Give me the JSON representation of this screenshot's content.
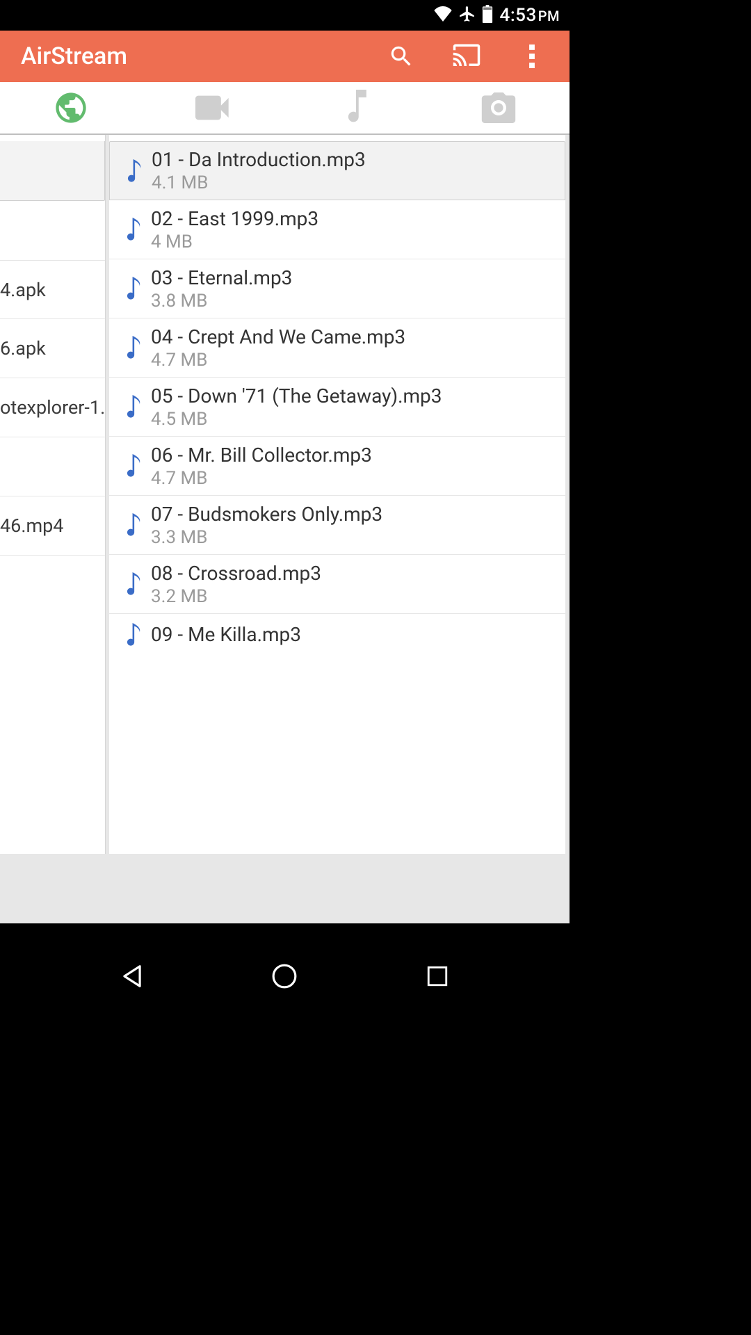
{
  "status": {
    "time": "4:53",
    "ampm": "PM"
  },
  "header": {
    "title": "AirStream"
  },
  "left_items": [
    {
      "label": "4.apk"
    },
    {
      "label": "6.apk"
    },
    {
      "label": "otexplorer-1.:"
    },
    {
      "label": ""
    },
    {
      "label": "46.mp4"
    }
  ],
  "files": [
    {
      "name": "01 - Da Introduction.mp3",
      "size": "4.1 MB",
      "selected": true
    },
    {
      "name": "02 - East 1999.mp3",
      "size": "4 MB"
    },
    {
      "name": "03 - Eternal.mp3",
      "size": "3.8 MB"
    },
    {
      "name": "04 - Crept And We Came.mp3",
      "size": "4.7 MB"
    },
    {
      "name": "05 - Down '71 (The Getaway).mp3",
      "size": "4.5 MB"
    },
    {
      "name": "06 - Mr. Bill Collector.mp3",
      "size": "4.7 MB"
    },
    {
      "name": "07 - Budsmokers Only.mp3",
      "size": "3.3 MB"
    },
    {
      "name": "08 - Crossroad.mp3",
      "size": "3.2 MB"
    },
    {
      "name": "09 - Me Killa.mp3",
      "size": ""
    }
  ]
}
